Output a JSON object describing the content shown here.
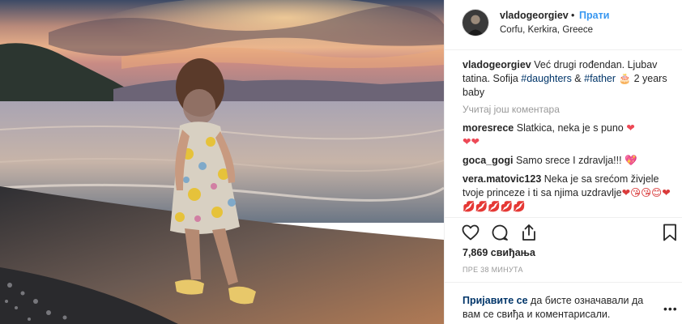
{
  "header": {
    "username": "vladogeorgiev",
    "separator": "•",
    "follow_label": "Прати",
    "location": "Corfu, Kerkira, Greece"
  },
  "caption": {
    "username": "vladogeorgiev",
    "text_1": "Već drugi rođendan. Ljubav tatina. Sofija ",
    "hashtag_1": "#daughters",
    "text_2": " & ",
    "hashtag_2": "#father",
    "emoji": "🎂",
    "text_3": " 2 years baby"
  },
  "load_more_label": "Учитај још коментара",
  "comments": [
    {
      "username": "moresrece",
      "text": "Slatkica, neka je s puno ",
      "emoji": "❤",
      "extra": "❤❤"
    },
    {
      "username": "goca_gogi",
      "text": "Samo srece I zdravlja!!! ",
      "emoji": "💖"
    },
    {
      "username": "vera.matovic123",
      "text": "Neka je sa srećom živjele tvoje princeze i ti sa njima uzdravlje",
      "emoji": "❤😘😘😊❤💋💋💋💋💋"
    }
  ],
  "actions": {
    "like_icon": "heart-outline",
    "comment_icon": "speech-bubble",
    "share_icon": "share-arrow",
    "save_icon": "bookmark"
  },
  "likes_text": "7,869 свиђања",
  "timestamp": "ПРЕ 38 МИНУТА",
  "login_prompt": {
    "link": "Пријавите се",
    "text": " да бисте означавали да вам се свиђа и коментарисали."
  },
  "more_label": "•••"
}
